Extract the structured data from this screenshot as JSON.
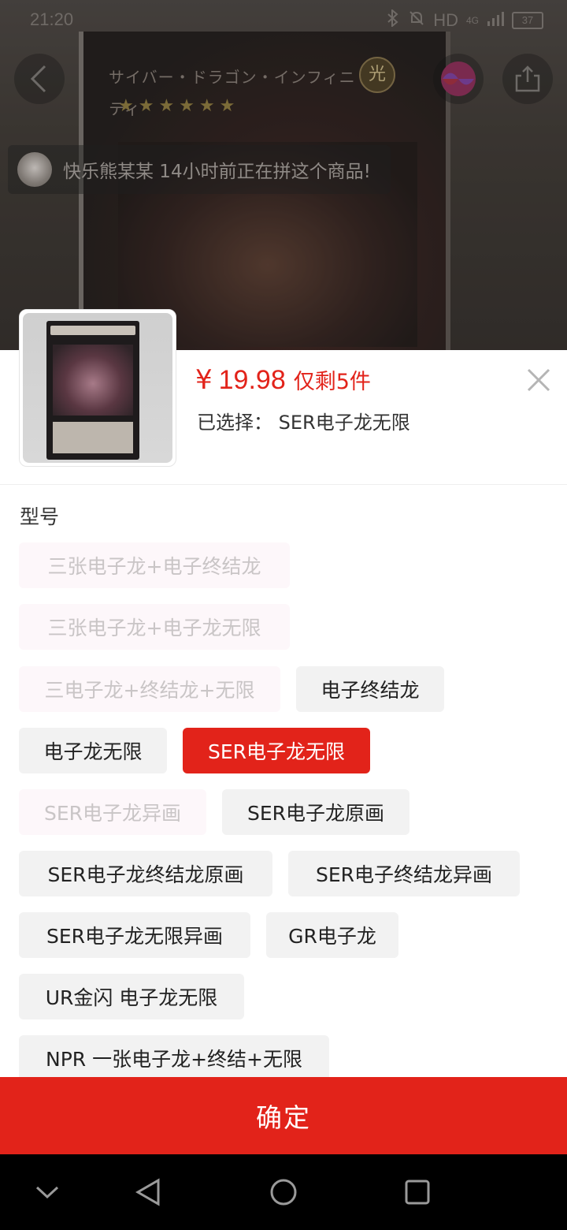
{
  "status_bar": {
    "time": "21:20",
    "network": "HD",
    "signal": "4G",
    "battery": "37"
  },
  "background": {
    "card_title": "サイバー・ドラゴン・インフィニティ",
    "card_attribute": "光"
  },
  "header": {
    "back_icon": "chevron-left-icon",
    "share_icon": "share-icon"
  },
  "ticker": {
    "text": "快乐熊某某 14小时前正在拼这个商品!"
  },
  "sheet": {
    "currency": "¥",
    "price": "19.98",
    "stock_text": "仅剩5件",
    "selected_text": "已选择： SER电子龙无限",
    "section_label": "型号",
    "options": [
      {
        "label": "三张电子龙+电子终结龙",
        "state": "disabled"
      },
      {
        "label": "三张电子龙+电子龙无限",
        "state": "disabled"
      },
      {
        "label": "三电子龙+终结龙+无限",
        "state": "disabled"
      },
      {
        "label": "电子终结龙",
        "state": "normal"
      },
      {
        "label": "电子龙无限",
        "state": "normal"
      },
      {
        "label": "SER电子龙无限",
        "state": "selected"
      },
      {
        "label": "SER电子龙异画",
        "state": "disabled"
      },
      {
        "label": "SER电子龙原画",
        "state": "normal"
      },
      {
        "label": "SER电子龙终结龙原画",
        "state": "normal"
      },
      {
        "label": "SER电子终结龙异画",
        "state": "normal"
      },
      {
        "label": "SER电子龙无限异画",
        "state": "normal"
      },
      {
        "label": "GR电子龙",
        "state": "normal"
      },
      {
        "label": "UR金闪 电子龙无限",
        "state": "normal"
      },
      {
        "label": "NPR 一张电子龙+终结+无限",
        "state": "normal"
      }
    ],
    "confirm_label": "确定"
  },
  "colors": {
    "accent": "#e2231a",
    "option_bg": "#f2f2f2",
    "disabled_text": "#c9c5c6"
  }
}
